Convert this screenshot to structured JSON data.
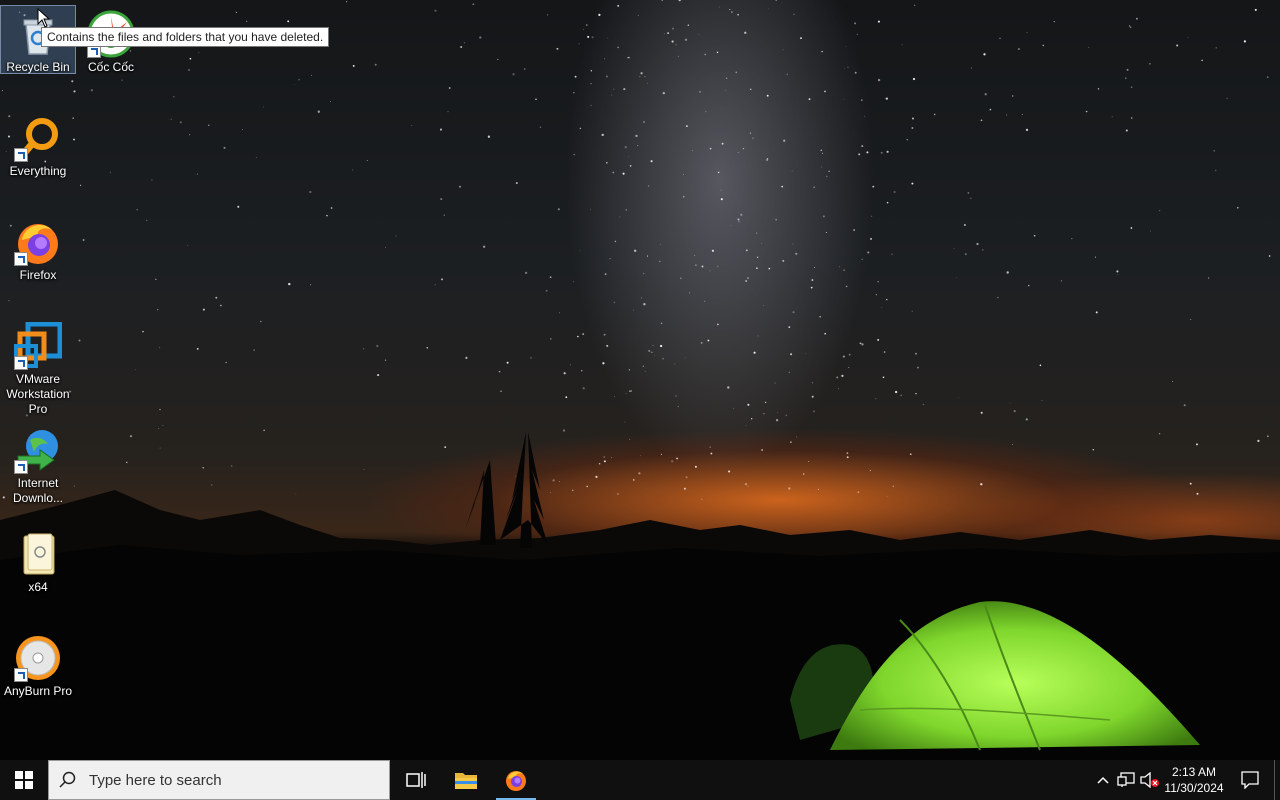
{
  "desktop": {
    "icons": [
      {
        "label": "Recycle Bin",
        "icon": "recycle-bin-icon"
      },
      {
        "label": "Cốc Cốc",
        "icon": "coccoc-browser-icon"
      },
      {
        "label": "Everything",
        "icon": "everything-search-icon"
      },
      {
        "label": "Firefox",
        "icon": "firefox-icon"
      },
      {
        "label": "VMware Workstation Pro",
        "icon": "vmware-icon"
      },
      {
        "label": "Internet Downlo...",
        "icon": "internet-download-manager-icon"
      },
      {
        "label": "x64",
        "icon": "folder-icon"
      },
      {
        "label": "AnyBurn Pro",
        "icon": "anyburn-disc-icon"
      }
    ],
    "tooltip": "Contains the files and folders that you have deleted."
  },
  "taskbar": {
    "search_placeholder": "Type here to search",
    "pinned": [
      {
        "name": "task-view",
        "icon": "task-view-icon"
      },
      {
        "name": "file-explorer",
        "icon": "folder-icon"
      },
      {
        "name": "firefox",
        "icon": "firefox-icon",
        "active": true
      }
    ],
    "tray": {
      "chevron_icon": "chevron-up-icon",
      "network_icon": "network-icon",
      "volume_icon": "volume-muted-icon"
    },
    "clock": {
      "time": "2:13 AM",
      "date": "11/30/2024"
    },
    "notification_icon": "action-center-icon"
  },
  "colors": {
    "taskbar_bg": "#101010",
    "active_indicator": "#76b9ed",
    "windows_logo": "#ffffff",
    "tent_green": "#8ee03a"
  }
}
